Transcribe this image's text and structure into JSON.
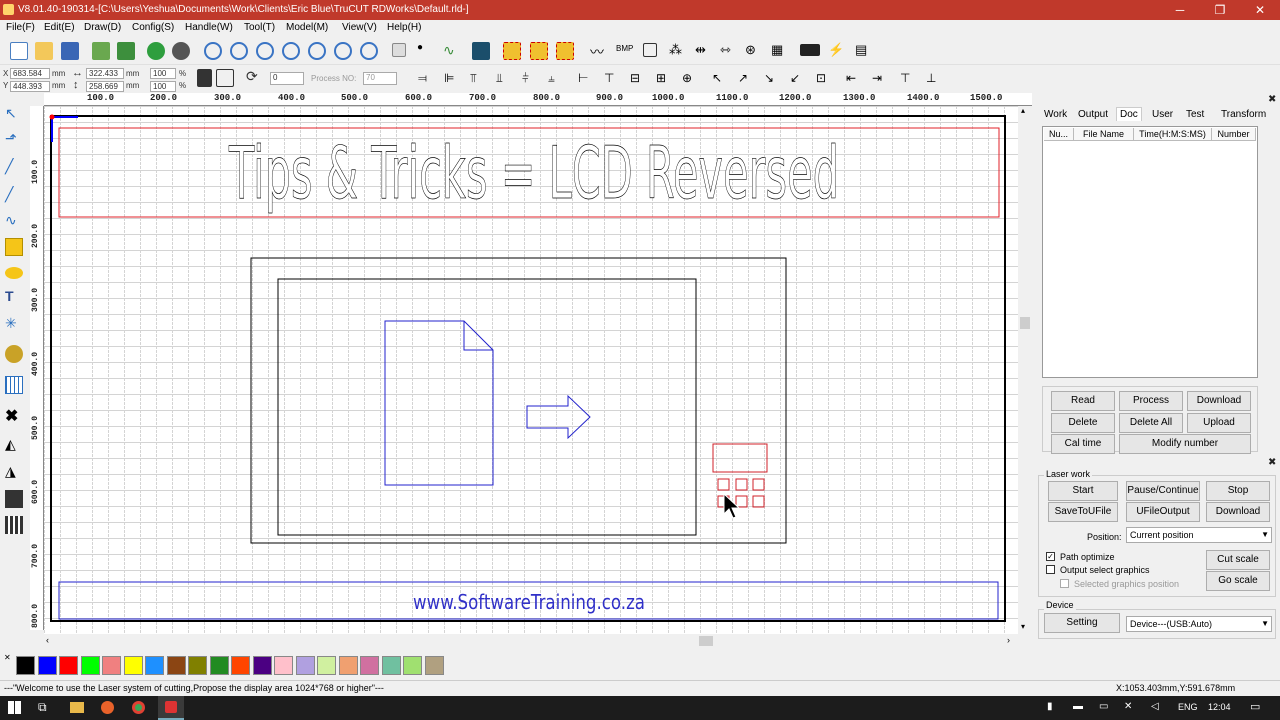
{
  "titlebar": {
    "title": "V8.01.40-190314-[C:\\Users\\Yeshua\\Documents\\Work\\Clients\\Eric Blue\\TruCUT RDWorks\\Default.rld-]",
    "minimize": "─",
    "maximize": "❐",
    "close": "✕"
  },
  "menu": [
    {
      "label": "File(F)"
    },
    {
      "label": "Edit(E)"
    },
    {
      "label": "Draw(D)"
    },
    {
      "label": "Config(S)"
    },
    {
      "label": "Handle(W)"
    },
    {
      "label": "Tool(T)"
    },
    {
      "label": "Model(M)"
    },
    {
      "label": "View(V)"
    },
    {
      "label": "Help(H)"
    }
  ],
  "coords": {
    "x_label": "X",
    "y_label": "Y",
    "x_value": "683.584",
    "y_value": "448.393",
    "x_unit": "mm",
    "y_unit": "mm",
    "w_value": "322.433",
    "h_value": "258.669",
    "w_unit": "mm",
    "h_unit": "mm",
    "scale_x": "100",
    "scale_y": "100",
    "pct_x": "%",
    "pct_y": "%",
    "angle_value": "0",
    "process_label": "Process NO:",
    "process_value": "70"
  },
  "ruler_h": [
    "100.0",
    "200.0",
    "300.0",
    "400.0",
    "500.0",
    "600.0",
    "700.0",
    "800.0",
    "900.0",
    "1000.0",
    "1100.0",
    "1200.0",
    "1300.0",
    "1400.0",
    "1500.0"
  ],
  "ruler_v": [
    "100.0",
    "200.0",
    "300.0",
    "400.0",
    "500.0",
    "600.0",
    "700.0",
    "800.0"
  ],
  "canvas": {
    "title_text": "Tips & Tricks = LCD Reversed",
    "footer_text": "www.SoftwareTraining.co.za"
  },
  "right_panel": {
    "tabs": [
      {
        "label": "Work"
      },
      {
        "label": "Output"
      },
      {
        "label": "Doc"
      },
      {
        "label": "User"
      },
      {
        "label": "Test"
      },
      {
        "label": "Transform"
      }
    ],
    "columns": [
      "Nu...",
      "File Name",
      "Time(H:M:S:MS)",
      "Number"
    ],
    "buttons": {
      "read": "Read",
      "process": "Process",
      "download": "Download",
      "delete": "Delete",
      "delete_all": "Delete All",
      "upload": "Upload",
      "cal_time": "Cal time",
      "modify_number": "Modify number"
    },
    "close": "✖"
  },
  "laser_work": {
    "group_title": "Laser work",
    "start": "Start",
    "pause": "Pause/Continue",
    "stop": "Stop",
    "save_to_ufile": "SaveToUFile",
    "ufile_output": "UFileOutput",
    "download": "Download",
    "position_label": "Position:",
    "position_value": "Current position",
    "path_optimize": "Path optimize",
    "path_optimize_checked": true,
    "output_select": "Output select graphics",
    "output_select_checked": false,
    "selected_position": "Selected graphics position",
    "cut_scale": "Cut scale",
    "go_scale": "Go scale",
    "device_title": "Device",
    "setting": "Setting",
    "device_value": "Device---(USB:Auto)",
    "close": "✖"
  },
  "palette": {
    "colors": [
      "#000000",
      "#0000ff",
      "#ff0000",
      "#00ff00",
      "#f08080",
      "#ffff00",
      "#1e90ff",
      "#8b4513",
      "#808000",
      "#228b22",
      "#ff4500",
      "#4b0082",
      "#ffc0cb",
      "#b0a0e0",
      "#d0f0a0",
      "#f0a070",
      "#d070a0",
      "#70c0a0",
      "#a0e070",
      "#b0a080"
    ],
    "close": "✕"
  },
  "statusbar": {
    "message": "---\"Welcome to use the Laser system of cutting,Propose the display area 1024*768 or higher\"---",
    "coords": "X:1053.403mm,Y:591.678mm"
  },
  "taskbar": {
    "lang": "ENG",
    "time": "12:04"
  }
}
